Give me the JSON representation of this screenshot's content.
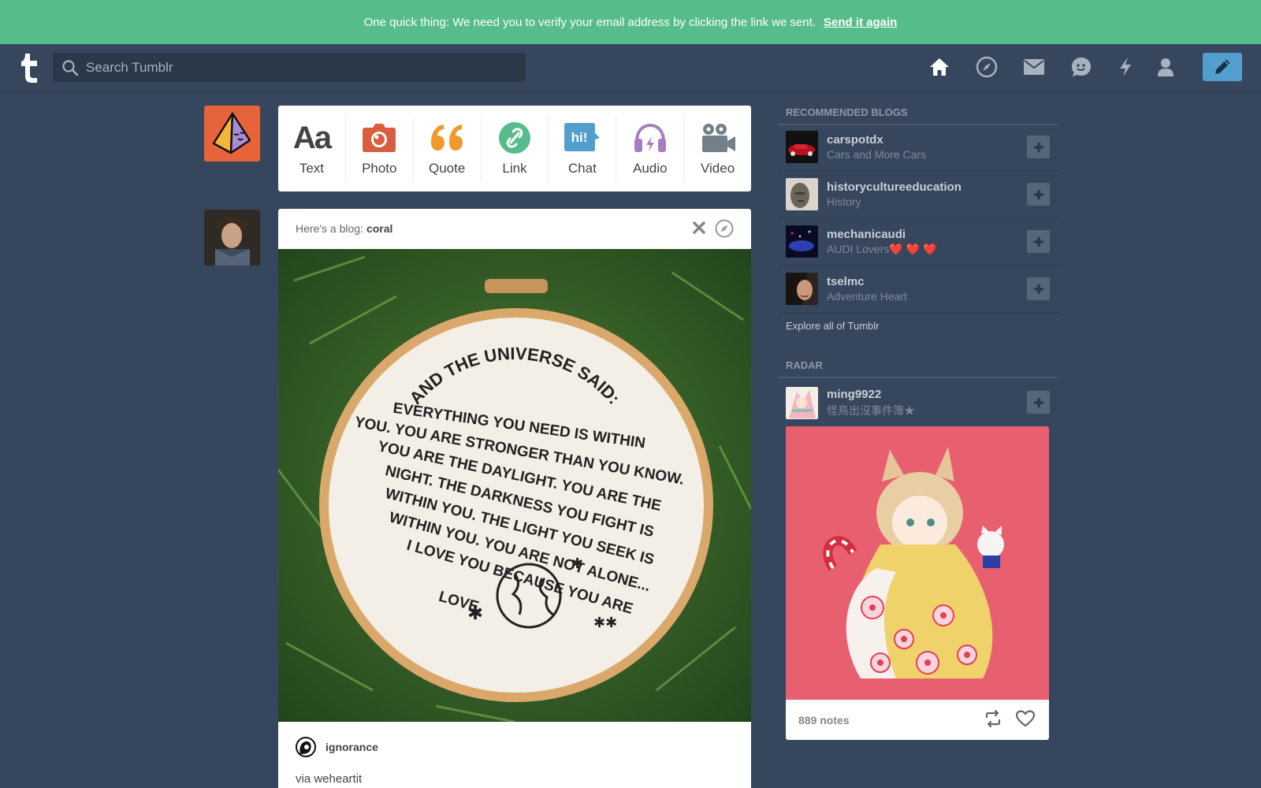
{
  "banner": {
    "message": "One quick thing:  We need you to verify your email address by clicking the link we sent.",
    "link_label": "Send it again"
  },
  "header": {
    "search_placeholder": "Search Tumblr",
    "nav_icons": [
      "home-icon",
      "explore-icon",
      "inbox-icon",
      "messaging-icon",
      "activity-icon",
      "account-icon"
    ],
    "compose_icon": "pencil-icon"
  },
  "post_types": [
    {
      "label": "Text",
      "icon": "text-icon",
      "color": "#444444"
    },
    {
      "label": "Photo",
      "icon": "photo-icon",
      "color": "#d95e40"
    },
    {
      "label": "Quote",
      "icon": "quote-icon",
      "color": "#f2992e"
    },
    {
      "label": "Link",
      "icon": "link-icon",
      "color": "#56bc8a"
    },
    {
      "label": "Chat",
      "icon": "chat-icon",
      "color": "#529ecc"
    },
    {
      "label": "Audio",
      "icon": "audio-icon",
      "color": "#a77dc2"
    },
    {
      "label": "Video",
      "icon": "video-icon",
      "color": "#748089"
    }
  ],
  "post": {
    "header_prefix": "Here's a blog:",
    "blog_name": "coral",
    "embroidery_text": [
      "AND THE UNIVERSE SAID:",
      "EVERYTHING YOU NEED IS WITHIN",
      "YOU. YOU ARE STRONGER THAN YOU KNOW.",
      "YOU ARE THE DAYLIGHT. YOU ARE THE",
      "NIGHT. THE DARKNESS YOU FIGHT IS",
      "WITHIN YOU. THE LIGHT YOU SEEK IS",
      "WITHIN YOU. YOU ARE NOT ALONE...",
      "I LOVE YOU BECAUSE YOU ARE",
      "LOVE."
    ],
    "source_name": "ignorance",
    "via_text": "via weheartit"
  },
  "recommended": {
    "heading": "Recommended Blogs",
    "items": [
      {
        "name": "carspotdx",
        "sub": "Cars and More Cars"
      },
      {
        "name": "historycultureeducation",
        "sub": "History"
      },
      {
        "name": "mechanicaudi",
        "sub": "AUDI Lovers❤️ ❤️ ❤️"
      },
      {
        "name": "tselmc",
        "sub": "Adventure Heart"
      }
    ],
    "explore_label": "Explore all of Tumblr"
  },
  "radar": {
    "heading": "Radar",
    "name": "ming9922",
    "sub": "怪鳥出沒事件簿★",
    "notes": "889 notes"
  },
  "colors": {
    "background": "#36465d",
    "banner": "#56bc8a",
    "accent": "#529ecc"
  }
}
